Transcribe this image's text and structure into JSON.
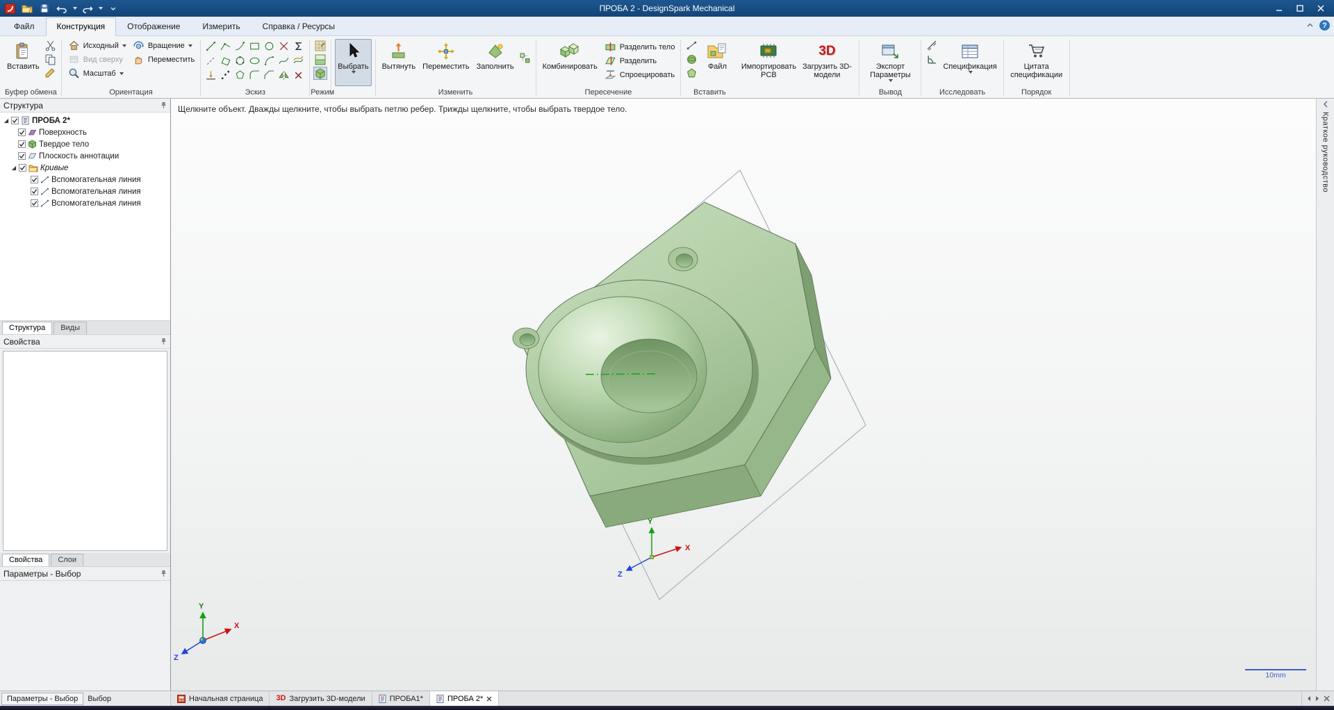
{
  "titlebar": {
    "title": "ПРОБА 2 - DesignSpark Mechanical"
  },
  "menu": {
    "tabs": [
      {
        "label": "Файл"
      },
      {
        "label": "Конструкция"
      },
      {
        "label": "Отображение"
      },
      {
        "label": "Измерить"
      },
      {
        "label": "Справка / Ресурсы"
      }
    ],
    "help_icon_text": "?"
  },
  "ribbon": {
    "clipboard": {
      "label": "Буфер обмена",
      "paste": "Вставить"
    },
    "orientation": {
      "label": "Ориентация",
      "home": "Исходный",
      "top_view": "Вид сверху",
      "zoom": "Масштаб",
      "spin": "Вращение",
      "pan": "Переместить"
    },
    "sketch": {
      "label": "Эскиз"
    },
    "mode": {
      "label": "Режим"
    },
    "edit": {
      "label": "Изменить",
      "select": "Выбрать",
      "pull": "Вытянуть",
      "move": "Переместить",
      "fill": "Заполнить"
    },
    "intersect": {
      "label": "Пересечение",
      "combine": "Комбинировать",
      "split_body": "Разделить тело",
      "split": "Разделить",
      "project": "Спроецировать"
    },
    "insert": {
      "label": "Вставить",
      "file": "Файл",
      "import_pcb": "Импортировать PCB",
      "load_3d": "Загрузить 3D-модели",
      "icon_3d_text": "3D"
    },
    "output": {
      "label": "Вывод",
      "export": "Экспорт Параметры"
    },
    "investigate": {
      "label": "Исследовать",
      "bom": "Спецификация"
    },
    "order": {
      "label": "Порядок",
      "quote": "Цитата спецификации"
    }
  },
  "structure_panel": {
    "header": "Структура",
    "root": {
      "label": "ПРОБА 2*"
    },
    "items": [
      {
        "label": "Поверхность"
      },
      {
        "label": "Твердое тело"
      },
      {
        "label": "Плоскость аннотации"
      },
      {
        "label": "Кривые"
      },
      {
        "label": "Вспомогательная линия"
      },
      {
        "label": "Вспомогательная линия"
      },
      {
        "label": "Вспомогательная линия"
      }
    ],
    "tabs": [
      {
        "label": "Структура"
      },
      {
        "label": "Виды"
      }
    ]
  },
  "properties_panel": {
    "header": "Свойства",
    "tabs": [
      {
        "label": "Свойства"
      },
      {
        "label": "Слои"
      }
    ]
  },
  "parameters_panel": {
    "header": "Параметры - Выбор"
  },
  "canvas": {
    "hint": "Щелкните объект. Дважды щелкните, чтобы выбрать петлю ребер. Трижды щелкните, чтобы выбрать твердое тело.",
    "scale_label": "10mm",
    "axes": {
      "x": "X",
      "y": "Y",
      "z": "Z"
    }
  },
  "quick_guide": {
    "label": "Краткое руководство"
  },
  "doc_tabs": [
    {
      "label": "Начальная страница"
    },
    {
      "label": "Загрузить 3D-модели",
      "icon_text": "3D"
    },
    {
      "label": "ПРОБА1*"
    },
    {
      "label": "ПРОБА 2*"
    }
  ],
  "status_bar": {
    "left_tab": "Параметры - Выбор",
    "selection_label": "Выбор"
  },
  "colors": {
    "titlebar": "#15497F",
    "model_green": "#abc9a0",
    "axis_x": "#cc1111",
    "axis_y": "#11a011",
    "axis_z": "#2244dd",
    "scalebar": "#3f5fc0"
  }
}
